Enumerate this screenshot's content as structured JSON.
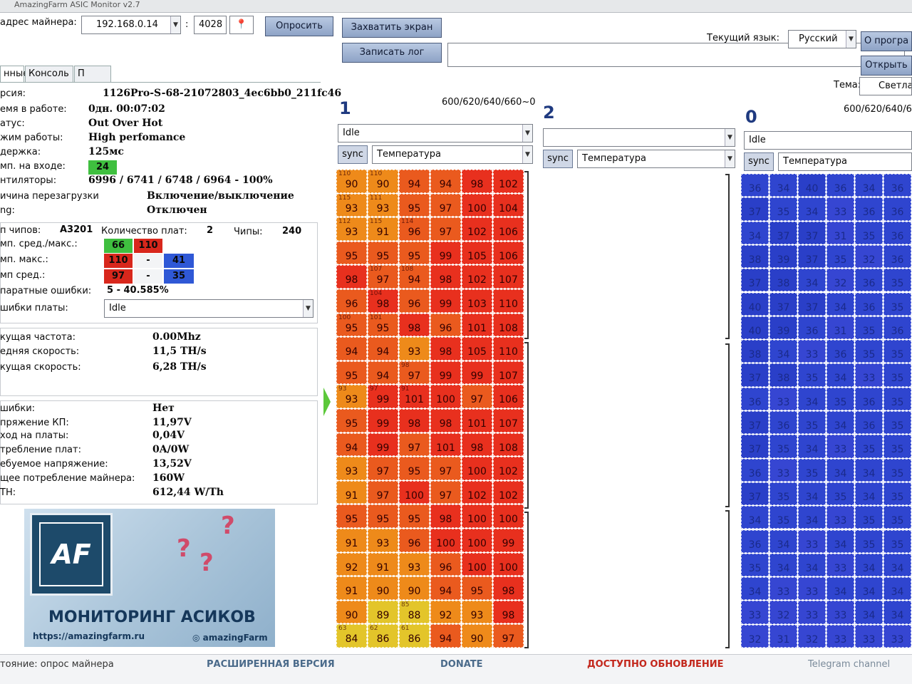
{
  "window": {
    "title": "AmazingFarm ASIC Monitor v2.7"
  },
  "toolbar": {
    "address_label": "адрес майнера:",
    "ip_value": "192.168.0.14",
    "port_sep": ":",
    "port_value": "4028",
    "poll_label": "Опросить",
    "capture_label": "Захватить экран",
    "log_label": "Записать лог",
    "log_path": "",
    "lang_label": "Текущий язык:",
    "lang_value": "Русский",
    "about_label": "О програ",
    "open_label": "Открыть",
    "theme_label": "Тема:",
    "theme_value": "Светла"
  },
  "tabs": [
    {
      "label": "нные"
    },
    {
      "label": "Консоль"
    },
    {
      "label": "П"
    }
  ],
  "info": [
    {
      "label": "рсия:",
      "value": "1126Pro-S-68-21072803_4ec6bb0_211fc46"
    },
    {
      "label": "емя в работе:",
      "value": "0дн. 00:07:02"
    },
    {
      "label": "атус:",
      "value": "Out Over Hot"
    },
    {
      "label": "жим работы:",
      "value": "High perfomance"
    },
    {
      "label": "держка:",
      "value": "125мс"
    },
    {
      "label": "мп. на входе:",
      "value": "24"
    },
    {
      "label": "нтиляторы:",
      "value": "6996 / 6741 / 6748 / 6964 - 100%"
    },
    {
      "label": "ичина перезагрузки",
      "value": "Включение/выключение"
    },
    {
      "label": "ng:",
      "value": "Отключен"
    }
  ],
  "chips": {
    "type_label": "п чипов:",
    "type_value": "A3201",
    "boards_label": "Количество плат:",
    "boards_value": "2",
    "chips_label": "Чипы:",
    "chips_value": "240",
    "avgmax_label": "мп. сред./макс.:",
    "avgmax_avg": "66",
    "avgmax_max": "110",
    "max_label": "мп. макс.:",
    "max_values": [
      "110",
      "-",
      "41"
    ],
    "avg_label": "мп сред.:",
    "avg_values": [
      "97",
      "-",
      "35"
    ],
    "hw_label": "паратные ошибки:",
    "hw_value": "5 - 40.585%",
    "board_err_label": "шибки платы:",
    "board_err_value": "Idle"
  },
  "speed": [
    {
      "label": "кущая частота:",
      "value": "0.00Mhz"
    },
    {
      "label": "едняя скорость:",
      "value": "11,5 TH/s"
    },
    {
      "label": "кущая скорость:",
      "value": "6,28 TH/s"
    }
  ],
  "power": [
    {
      "label": "шибки:",
      "value": "Нет"
    },
    {
      "label": "пряжение КП:",
      "value": "11,97V"
    },
    {
      "label": "ход на платы:",
      "value": "0,04V"
    },
    {
      "label": "требление плат:",
      "value": "0A/0W"
    },
    {
      "label": "ебуемое напряжение:",
      "value": "13,52V"
    },
    {
      "label": "щее потребление майнера:",
      "value": "160W"
    },
    {
      "label": "TH:",
      "value": "612,44 W/Th"
    }
  ],
  "banner": {
    "logo_text": "AF",
    "logo_caption": "AMAZING FARM",
    "title": "МОНИТОРИНГ АСИКОВ",
    "url": "https://amazingfarm.ru",
    "brand": "amazingFarm"
  },
  "boards": [
    {
      "number": "1",
      "freq": "600/620/640/660~0",
      "state": "Idle",
      "sync": "sync",
      "mode": "Температура",
      "rows": [
        {
          "small": [
            "110",
            "110",
            "",
            "",
            "",
            ""
          ],
          "temps": [
            "90",
            "90",
            "94",
            "94",
            "98",
            "102"
          ]
        },
        {
          "small": [
            "115",
            "111",
            "",
            "",
            "",
            ""
          ],
          "temps": [
            "93",
            "93",
            "95",
            "97",
            "100",
            "104"
          ]
        },
        {
          "small": [
            "112",
            "115",
            "114",
            "",
            "",
            ""
          ],
          "temps": [
            "93",
            "91",
            "96",
            "97",
            "102",
            "106"
          ]
        },
        {
          "small": [
            "",
            "",
            "",
            "",
            "",
            ""
          ],
          "temps": [
            "95",
            "95",
            "95",
            "99",
            "105",
            "106"
          ]
        },
        {
          "small": [
            "",
            "107",
            "108",
            "",
            "",
            ""
          ],
          "temps": [
            "98",
            "97",
            "94",
            "98",
            "102",
            "107"
          ]
        },
        {
          "small": [
            "",
            "104",
            "",
            "",
            "",
            ""
          ],
          "temps": [
            "96",
            "98",
            "96",
            "99",
            "103",
            "110"
          ]
        },
        {
          "small": [
            "100",
            "101",
            "",
            "",
            "",
            ""
          ],
          "temps": [
            "95",
            "95",
            "98",
            "96",
            "101",
            "108"
          ]
        },
        {
          "small": [
            "",
            "",
            "",
            "",
            "",
            ""
          ],
          "temps": [
            "94",
            "94",
            "93",
            "98",
            "105",
            "110"
          ]
        },
        {
          "small": [
            "",
            "",
            "98",
            "",
            "",
            ""
          ],
          "temps": [
            "95",
            "94",
            "97",
            "99",
            "99",
            "107"
          ]
        },
        {
          "small": [
            "93",
            "97",
            "91",
            "",
            "",
            ""
          ],
          "temps": [
            "93",
            "99",
            "101",
            "100",
            "97",
            "106"
          ]
        },
        {
          "small": [
            "",
            "",
            "",
            "",
            "",
            ""
          ],
          "temps": [
            "95",
            "99",
            "98",
            "98",
            "101",
            "107"
          ]
        },
        {
          "small": [
            "",
            "",
            "",
            "",
            "",
            ""
          ],
          "temps": [
            "94",
            "99",
            "97",
            "101",
            "98",
            "108"
          ]
        },
        {
          "small": [
            "",
            "",
            "",
            "",
            "",
            ""
          ],
          "temps": [
            "93",
            "97",
            "95",
            "97",
            "100",
            "102"
          ]
        },
        {
          "small": [
            "",
            "",
            "",
            "",
            "",
            ""
          ],
          "temps": [
            "91",
            "97",
            "100",
            "97",
            "102",
            "102"
          ]
        },
        {
          "small": [
            "",
            "",
            "",
            "",
            "",
            ""
          ],
          "temps": [
            "95",
            "95",
            "95",
            "98",
            "100",
            "100"
          ]
        },
        {
          "small": [
            "",
            "",
            "",
            "",
            "",
            ""
          ],
          "temps": [
            "91",
            "93",
            "96",
            "100",
            "100",
            "99"
          ]
        },
        {
          "small": [
            "",
            "",
            "",
            "",
            "",
            ""
          ],
          "temps": [
            "92",
            "91",
            "93",
            "96",
            "100",
            "100"
          ]
        },
        {
          "small": [
            "",
            "",
            "",
            "",
            "",
            ""
          ],
          "temps": [
            "91",
            "90",
            "90",
            "94",
            "95",
            "98"
          ]
        },
        {
          "small": [
            "",
            "",
            "85",
            "",
            "",
            ""
          ],
          "temps": [
            "90",
            "89",
            "88",
            "92",
            "93",
            "98"
          ]
        },
        {
          "small": [
            "63",
            "62",
            "61",
            "",
            "",
            ""
          ],
          "temps": [
            "84",
            "86",
            "86",
            "94",
            "90",
            "97"
          ]
        }
      ]
    },
    {
      "number": "2",
      "freq": "",
      "state": "",
      "sync": "sync",
      "mode": "Температура"
    },
    {
      "number": "0",
      "freq": "600/620/640/66",
      "state": "Idle",
      "sync": "sync",
      "mode": "Температура",
      "rows": [
        {
          "small": [
            "",
            "",
            "",
            "",
            "",
            ""
          ],
          "temps": [
            "36",
            "34",
            "40",
            "36",
            "34",
            "36"
          ]
        },
        {
          "small": [
            "",
            "",
            "",
            "",
            "",
            ""
          ],
          "temps": [
            "37",
            "35",
            "34",
            "33",
            "36",
            "36"
          ]
        },
        {
          "small": [
            "",
            "",
            "",
            "",
            "",
            ""
          ],
          "temps": [
            "34",
            "37",
            "37",
            "31",
            "35",
            "36"
          ]
        },
        {
          "small": [
            "",
            "",
            "",
            "",
            "",
            ""
          ],
          "temps": [
            "38",
            "39",
            "37",
            "35",
            "32",
            "36"
          ]
        },
        {
          "small": [
            "",
            "",
            "",
            "",
            "",
            ""
          ],
          "temps": [
            "37",
            "38",
            "34",
            "32",
            "36",
            "35"
          ]
        },
        {
          "small": [
            "",
            "",
            "",
            "",
            "",
            ""
          ],
          "temps": [
            "40",
            "37",
            "37",
            "34",
            "36",
            "35"
          ]
        },
        {
          "small": [
            "",
            "",
            "",
            "",
            "",
            ""
          ],
          "temps": [
            "40",
            "39",
            "36",
            "31",
            "35",
            "36"
          ]
        },
        {
          "small": [
            "",
            "",
            "",
            "",
            "",
            ""
          ],
          "temps": [
            "38",
            "34",
            "33",
            "36",
            "35",
            "35"
          ]
        },
        {
          "small": [
            "",
            "",
            "",
            "",
            "",
            ""
          ],
          "temps": [
            "37",
            "38",
            "35",
            "34",
            "33",
            "35"
          ]
        },
        {
          "small": [
            "",
            "",
            "",
            "",
            "",
            ""
          ],
          "temps": [
            "36",
            "33",
            "34",
            "35",
            "36",
            "35"
          ]
        },
        {
          "small": [
            "",
            "",
            "",
            "",
            "",
            ""
          ],
          "temps": [
            "37",
            "36",
            "35",
            "34",
            "36",
            "35"
          ]
        },
        {
          "small": [
            "",
            "",
            "",
            "",
            "",
            ""
          ],
          "temps": [
            "37",
            "35",
            "34",
            "33",
            "35",
            "35"
          ]
        },
        {
          "small": [
            "",
            "",
            "",
            "",
            "",
            ""
          ],
          "temps": [
            "36",
            "33",
            "35",
            "34",
            "34",
            "35"
          ]
        },
        {
          "small": [
            "",
            "",
            "",
            "",
            "",
            ""
          ],
          "temps": [
            "37",
            "35",
            "34",
            "35",
            "34",
            "35"
          ]
        },
        {
          "small": [
            "",
            "",
            "",
            "",
            "",
            ""
          ],
          "temps": [
            "34",
            "35",
            "34",
            "33",
            "35",
            "35"
          ]
        },
        {
          "small": [
            "",
            "",
            "",
            "",
            "",
            ""
          ],
          "temps": [
            "36",
            "34",
            "33",
            "34",
            "35",
            "35"
          ]
        },
        {
          "small": [
            "",
            "",
            "",
            "",
            "",
            ""
          ],
          "temps": [
            "35",
            "34",
            "34",
            "33",
            "34",
            "34"
          ]
        },
        {
          "small": [
            "",
            "",
            "",
            "",
            "",
            ""
          ],
          "temps": [
            "34",
            "33",
            "33",
            "34",
            "34",
            "34"
          ]
        },
        {
          "small": [
            "",
            "",
            "",
            "",
            "",
            ""
          ],
          "temps": [
            "33",
            "32",
            "33",
            "33",
            "34",
            "34"
          ]
        },
        {
          "small": [
            "",
            "",
            "",
            "",
            "",
            ""
          ],
          "temps": [
            "32",
            "31",
            "32",
            "33",
            "33",
            "33"
          ]
        }
      ]
    }
  ],
  "status": {
    "state": "тояние: опрос майнера",
    "extended": "РАСШИРЕННАЯ ВЕРСИЯ",
    "donate": "DONATE",
    "update": "ДОСТУПНО ОБНОВЛЕНИЕ",
    "telegram": "Telegram channel"
  },
  "colors": {
    "hot": "#e8301e",
    "warm": "#ee8a1a",
    "cool": "#e3c52a",
    "blue": "#2f43c9",
    "green_badge": "#3fbf3f",
    "red_badge": "#d8271c",
    "blue_badge": "#2f58d6"
  }
}
